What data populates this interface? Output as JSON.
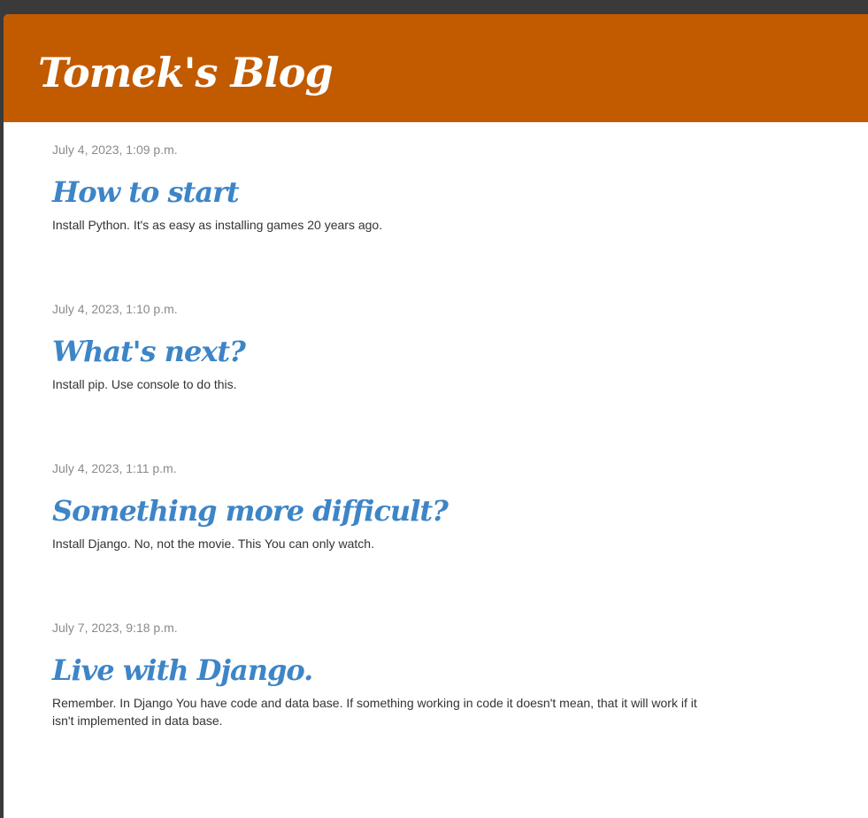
{
  "header": {
    "title": "Tomek's Blog"
  },
  "posts": [
    {
      "date": "July 4, 2023, 1:09 p.m.",
      "title": "How to start",
      "body": "Install Python. It's as easy as installing games 20 years ago."
    },
    {
      "date": "July 4, 2023, 1:10 p.m.",
      "title": "What's next?",
      "body": "Install pip. Use console to do this."
    },
    {
      "date": "July 4, 2023, 1:11 p.m.",
      "title": "Something more difficult?",
      "body": "Install Django. No, not the movie. This You can only watch."
    },
    {
      "date": "July 7, 2023, 9:18 p.m.",
      "title": "Live with Django.",
      "body": "Remember. In Django You have code and data base. If something working in code it doesn't mean, that it will work if it isn't implemented in data base."
    }
  ],
  "colors": {
    "header_bg": "#c25a00",
    "title_link": "#3d85c6",
    "date_text": "#8a8a8a",
    "body_text": "#333333"
  }
}
